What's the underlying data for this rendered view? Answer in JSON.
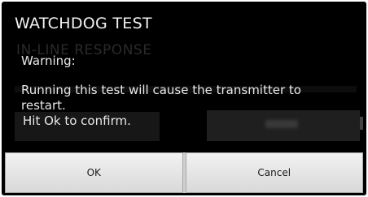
{
  "dialog": {
    "title": "WATCHDOG TEST",
    "warning": "Warning:",
    "message_line1": "Running this test will cause the transmitter to",
    "message_line2": "restart.",
    "message_line3": "Hit Ok to confirm."
  },
  "buttons": {
    "ok_label": "OK",
    "cancel_label": "Cancel"
  },
  "background_screen": {
    "heading": "IN-LINE RESPONSE"
  },
  "colors": {
    "dialog_background": "#000000",
    "text": "#f2f2f2",
    "button_face": "#e6e6e6"
  }
}
